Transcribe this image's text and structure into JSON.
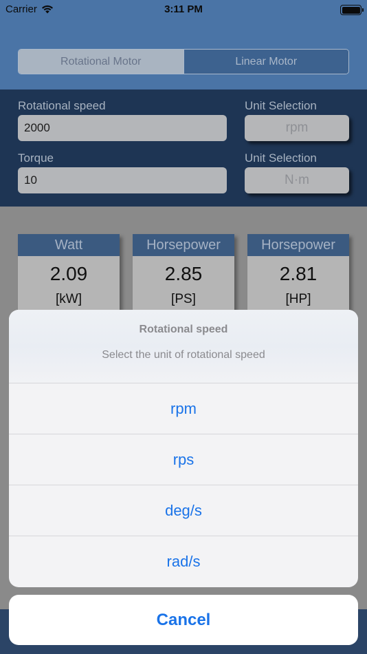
{
  "status_bar": {
    "carrier": "Carrier",
    "time": "3:11 PM"
  },
  "mode_tabs": {
    "rotational": "Rotational Motor",
    "linear": "Linear Motor",
    "selected": "Rotational Motor"
  },
  "inputs": {
    "speed_label": "Rotational speed",
    "speed_value": "2000",
    "speed_unit_label": "Unit Selection",
    "speed_unit": "rpm",
    "torque_label": "Torque",
    "torque_value": "10",
    "torque_unit_label": "Unit Selection",
    "torque_unit": "N·m"
  },
  "results": [
    {
      "title": "Watt",
      "value": "2.09",
      "unit": "[kW]"
    },
    {
      "title": "Horsepower",
      "value": "2.85",
      "unit": "[PS]"
    },
    {
      "title": "Horsepower",
      "value": "2.81",
      "unit": "[HP]"
    }
  ],
  "action_sheet": {
    "title": "Rotational speed",
    "message": "Select the unit of rotational speed",
    "options": [
      "rpm",
      "rps",
      "deg/s",
      "rad/s"
    ],
    "cancel": "Cancel"
  },
  "colors": {
    "accent": "#1a73e8",
    "header_blue": "#4a74a6",
    "panel_navy": "#1e3554"
  }
}
